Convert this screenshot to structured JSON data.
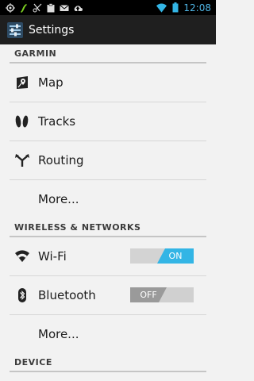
{
  "status_bar": {
    "time": "12:08",
    "icons": [
      "gps-icon",
      "garmin-icon",
      "scissors-icon",
      "clipboard-icon",
      "mail-icon",
      "upload-icon",
      "wifi-signal-icon",
      "battery-icon"
    ]
  },
  "action_bar": {
    "title": "Settings"
  },
  "sections": {
    "garmin": "GARMIN",
    "wireless": "WIRELESS & NETWORKS",
    "device": "DEVICE"
  },
  "garmin_items": {
    "map": "Map",
    "tracks": "Tracks",
    "routing": "Routing",
    "more": "More..."
  },
  "wireless_items": {
    "wifi": "Wi-Fi",
    "wifi_toggle": "ON",
    "bluetooth": "Bluetooth",
    "bluetooth_toggle": "OFF",
    "more": "More..."
  },
  "colors": {
    "accent": "#33b5e5",
    "clock": "#4fb6e6",
    "background": "#f2f2f2"
  }
}
